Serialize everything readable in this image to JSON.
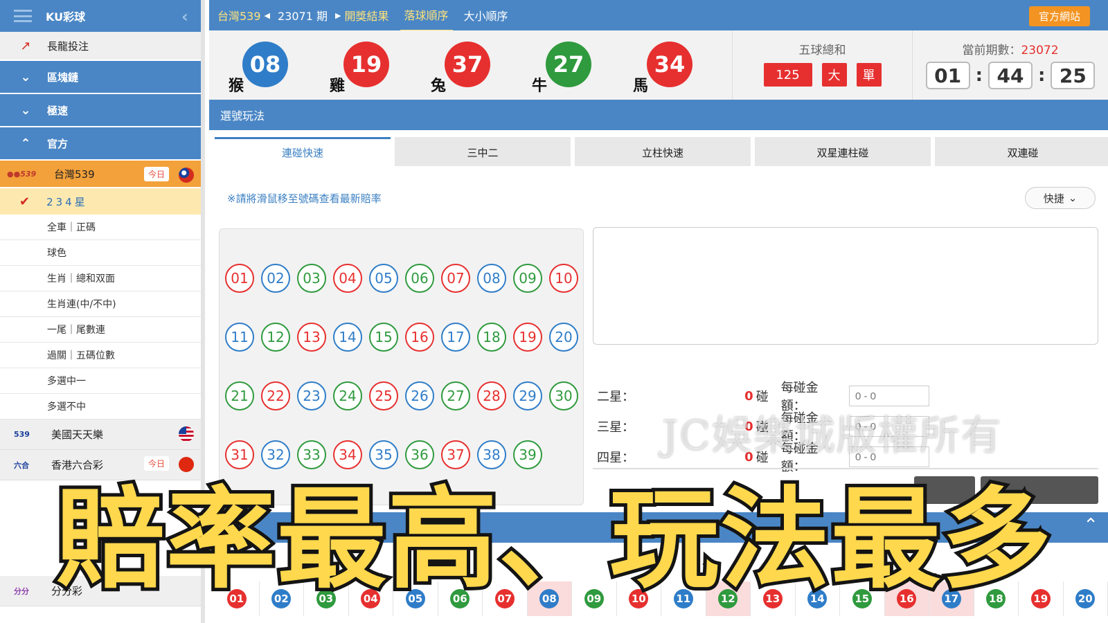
{
  "sidebar": {
    "brand": "KU彩球",
    "menu": [
      {
        "label": "長龍投注",
        "style": "grey",
        "icon": "trend-icon"
      },
      {
        "label": "區塊鏈",
        "style": "blue",
        "icon": "chevron-down-icon"
      },
      {
        "label": "極速",
        "style": "blue",
        "icon": "chevron-down-icon"
      },
      {
        "label": "官方",
        "style": "blue",
        "icon": "chevron-up-icon"
      }
    ],
    "active_game": {
      "label": "台灣539",
      "badge": "今日"
    },
    "selected_sub": "234星",
    "subs": [
      "全車｜正碼",
      "球色",
      "生肖｜總和双面",
      "生肖連(中/不中)",
      "一尾｜尾數連",
      "過關｜五碼位數",
      "多選中一",
      "多選不中"
    ],
    "lotteries": [
      {
        "label": "美國天天樂",
        "flag": "us"
      },
      {
        "label": "香港六合彩",
        "badge": "今日",
        "flag": "hk"
      }
    ],
    "bottom_item": "分分彩"
  },
  "topbar": {
    "game": "台灣539",
    "period": "23071 期",
    "links": [
      "開獎結果",
      "落球順序"
    ],
    "active_link": "落球順序",
    "plain_link": "大小順序",
    "official_button": "官方網站"
  },
  "result": {
    "balls": [
      {
        "num": "08",
        "zodiac": "猴",
        "color": "#2f7dc8"
      },
      {
        "num": "19",
        "zodiac": "雞",
        "color": "#e6302f"
      },
      {
        "num": "37",
        "zodiac": "兔",
        "color": "#e6302f"
      },
      {
        "num": "27",
        "zodiac": "牛",
        "color": "#2f9a3e"
      },
      {
        "num": "34",
        "zodiac": "馬",
        "color": "#e6302f"
      }
    ],
    "sum_title": "五球總和",
    "sum_value": "125",
    "sum_size": "大",
    "sum_parity": "單",
    "current_label": "當前期數：",
    "current_period": "23072",
    "timer": [
      "01",
      "44",
      "25"
    ]
  },
  "picker": {
    "title": "選號玩法",
    "tabs": [
      "連碰快速",
      "三中二",
      "立柱快速",
      "双星連柱碰",
      "双連碰"
    ],
    "active_tab": 0,
    "notice": "※請將滑鼠移至號碼查看最新賠率",
    "quick_label": "快捷",
    "numbers": [
      {
        "n": "01",
        "c": "red"
      },
      {
        "n": "02",
        "c": "blue"
      },
      {
        "n": "03",
        "c": "green"
      },
      {
        "n": "04",
        "c": "red"
      },
      {
        "n": "05",
        "c": "blue"
      },
      {
        "n": "06",
        "c": "green"
      },
      {
        "n": "07",
        "c": "red"
      },
      {
        "n": "08",
        "c": "blue"
      },
      {
        "n": "09",
        "c": "green"
      },
      {
        "n": "10",
        "c": "red"
      },
      {
        "n": "11",
        "c": "blue"
      },
      {
        "n": "12",
        "c": "green"
      },
      {
        "n": "13",
        "c": "red"
      },
      {
        "n": "14",
        "c": "blue"
      },
      {
        "n": "15",
        "c": "green"
      },
      {
        "n": "16",
        "c": "red"
      },
      {
        "n": "17",
        "c": "blue"
      },
      {
        "n": "18",
        "c": "green"
      },
      {
        "n": "19",
        "c": "red"
      },
      {
        "n": "20",
        "c": "blue"
      },
      {
        "n": "21",
        "c": "green"
      },
      {
        "n": "22",
        "c": "red"
      },
      {
        "n": "23",
        "c": "blue"
      },
      {
        "n": "24",
        "c": "green"
      },
      {
        "n": "25",
        "c": "red"
      },
      {
        "n": "26",
        "c": "blue"
      },
      {
        "n": "27",
        "c": "green"
      },
      {
        "n": "28",
        "c": "red"
      },
      {
        "n": "29",
        "c": "blue"
      },
      {
        "n": "30",
        "c": "green"
      },
      {
        "n": "31",
        "c": "red"
      },
      {
        "n": "32",
        "c": "blue"
      },
      {
        "n": "33",
        "c": "green"
      },
      {
        "n": "34",
        "c": "red"
      },
      {
        "n": "35",
        "c": "blue"
      },
      {
        "n": "36",
        "c": "green"
      },
      {
        "n": "37",
        "c": "red"
      },
      {
        "n": "38",
        "c": "blue"
      },
      {
        "n": "39",
        "c": "green"
      }
    ],
    "stars": [
      {
        "name": "二星：",
        "count": "0",
        "unit": "碰",
        "amount_label": "每碰金額：",
        "placeholder": "0 - 0"
      },
      {
        "name": "三星：",
        "count": "0",
        "unit": "碰",
        "amount_label": "每碰金額：",
        "placeholder": "0 - 0"
      },
      {
        "name": "四星：",
        "count": "0",
        "unit": "碰",
        "amount_label": "每碰金額：",
        "placeholder": "0 - 0"
      }
    ]
  },
  "watermark": "JC娛樂城版權所有",
  "history": [
    {
      "n": "01",
      "c": "#e6302f"
    },
    {
      "n": "02",
      "c": "#2f7dc8"
    },
    {
      "n": "03",
      "c": "#2f9a3e"
    },
    {
      "n": "04",
      "c": "#e6302f"
    },
    {
      "n": "05",
      "c": "#2f7dc8"
    },
    {
      "n": "06",
      "c": "#2f9a3e"
    },
    {
      "n": "07",
      "c": "#e6302f"
    },
    {
      "n": "08",
      "c": "#2f7dc8",
      "hl": true
    },
    {
      "n": "09",
      "c": "#2f9a3e"
    },
    {
      "n": "10",
      "c": "#e6302f"
    },
    {
      "n": "11",
      "c": "#2f7dc8"
    },
    {
      "n": "12",
      "c": "#2f9a3e",
      "hl": true
    },
    {
      "n": "13",
      "c": "#e6302f"
    },
    {
      "n": "14",
      "c": "#2f7dc8"
    },
    {
      "n": "15",
      "c": "#2f9a3e"
    },
    {
      "n": "16",
      "c": "#e6302f",
      "hl": true
    },
    {
      "n": "17",
      "c": "#2f7dc8",
      "hl": true
    },
    {
      "n": "18",
      "c": "#2f9a3e"
    },
    {
      "n": "19",
      "c": "#e6302f"
    },
    {
      "n": "20",
      "c": "#2f7dc8"
    }
  ],
  "banner": "賠率最高、玩法最多"
}
